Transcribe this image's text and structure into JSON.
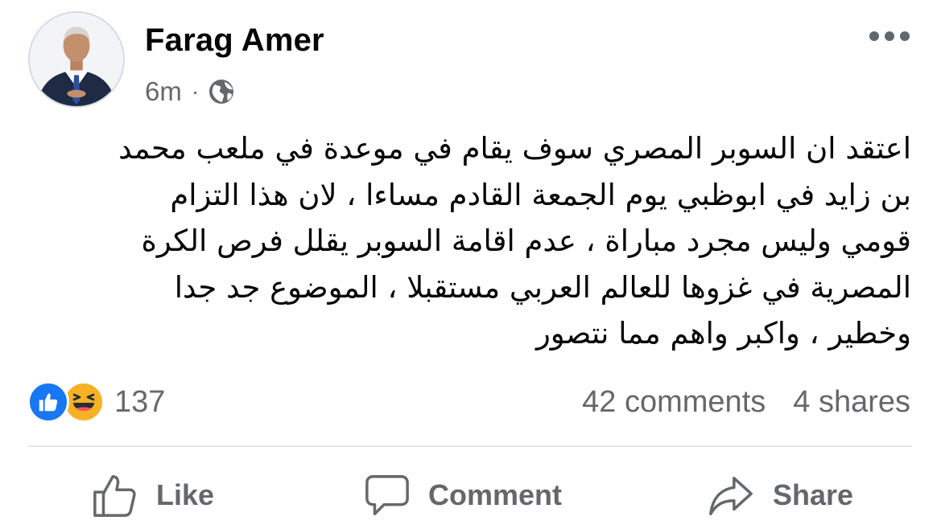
{
  "post": {
    "author": "Farag Amer",
    "timestamp": "6m",
    "separator": "·",
    "privacy_icon": "globe-icon",
    "more_icon": "more-options-icon",
    "text_lines": [
      "اعتقد ان السوبر المصري سوف يقام في موعدة في ملعب محمد",
      "بن زايد في ابوظبي يوم الجمعة القادم مساءا ، لان هذا التزام",
      "قومي وليس  مجرد مباراة ، عدم اقامة السوبر يقلل فرص الكرة",
      "المصرية في غزوها للعالم العربي مستقبلا ، الموضوع جد جدا",
      "وخطير ، واكبر واهم مما نتصور"
    ]
  },
  "reactions": {
    "icons": [
      "like-reaction-icon",
      "haha-reaction-icon"
    ],
    "count": "137",
    "comments": "42 comments",
    "shares": "4 shares"
  },
  "actions": {
    "like": "Like",
    "comment": "Comment",
    "share": "Share"
  },
  "colors": {
    "primary_text": "#050505",
    "secondary_text": "#65676b",
    "like_blue": "#1877f2",
    "haha_yellow": "#f7b125",
    "divider": "#e4e6eb"
  }
}
